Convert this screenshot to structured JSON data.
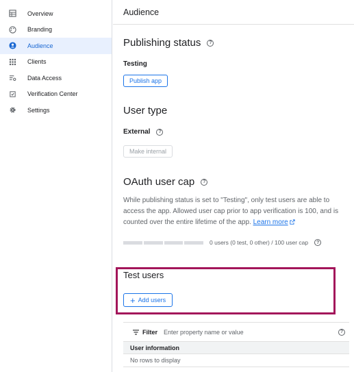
{
  "sidebar": {
    "items": [
      {
        "label": "Overview",
        "icon": "table-icon"
      },
      {
        "label": "Branding",
        "icon": "palette-icon"
      },
      {
        "label": "Audience",
        "icon": "person-circle-icon",
        "active": true
      },
      {
        "label": "Clients",
        "icon": "grid-icon"
      },
      {
        "label": "Data Access",
        "icon": "filter-settings-icon"
      },
      {
        "label": "Verification Center",
        "icon": "check-box-icon"
      },
      {
        "label": "Settings",
        "icon": "gear-icon"
      }
    ]
  },
  "header": {
    "title": "Audience"
  },
  "publishing": {
    "title": "Publishing status",
    "status": "Testing",
    "publish_button": "Publish app"
  },
  "user_type": {
    "title": "User type",
    "value": "External",
    "make_internal_button": "Make internal"
  },
  "oauth_cap": {
    "title": "OAuth user cap",
    "description": "While publishing status is set to \"Testing\", only test users are able to access the app. Allowed user cap prior to app verification is 100, and is counted over the entire lifetime of the app.",
    "learn_more": "Learn more",
    "usage_text": "0 users (0 test, 0 other) / 100 user cap",
    "usage_fraction": 0
  },
  "test_users": {
    "title": "Test users",
    "add_button": "Add users"
  },
  "table": {
    "filter_label": "Filter",
    "filter_placeholder": "Enter property name or value",
    "column_header": "User information",
    "empty_text": "No rows to display"
  },
  "colors": {
    "accent": "#1a73e8",
    "active_bg": "#e8f0fe",
    "highlight_border": "#a3155a"
  }
}
